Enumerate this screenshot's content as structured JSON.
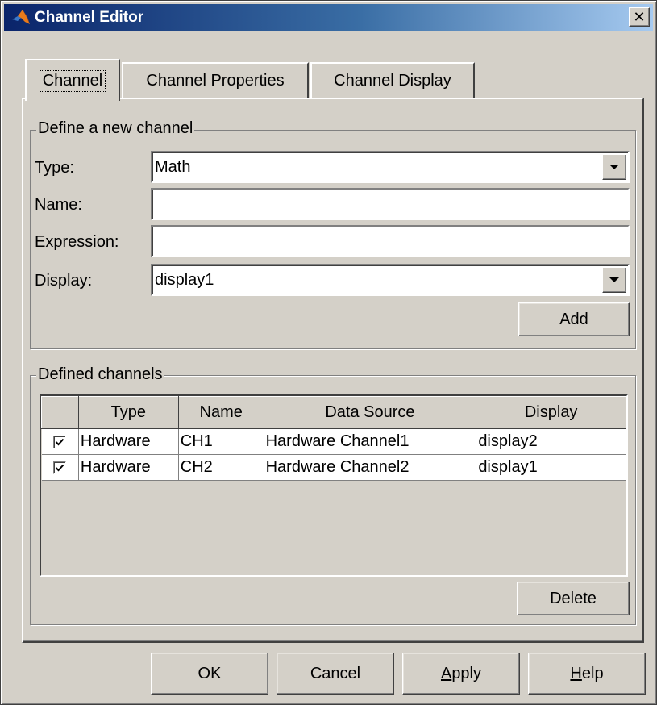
{
  "window": {
    "title": "Channel Editor"
  },
  "tabs": [
    {
      "label": "Channel",
      "active": true
    },
    {
      "label": "Channel Properties",
      "active": false
    },
    {
      "label": "Channel Display",
      "active": false
    }
  ],
  "define": {
    "group_label": "Define a new channel",
    "type_label": "Type:",
    "type_value": "Math",
    "name_label": "Name:",
    "name_value": "",
    "expression_label": "Expression:",
    "expression_value": "",
    "display_label": "Display:",
    "display_value": "display1",
    "add_button": "Add"
  },
  "defined": {
    "group_label": "Defined channels",
    "columns": [
      "",
      "Type",
      "Name",
      "Data Source",
      "Display"
    ],
    "rows": [
      {
        "checked": true,
        "type": "Hardware",
        "name": "CH1",
        "source": "Hardware Channel1",
        "display": "display2"
      },
      {
        "checked": true,
        "type": "Hardware",
        "name": "CH2",
        "source": "Hardware Channel2",
        "display": "display1"
      }
    ],
    "delete_button": "Delete"
  },
  "footer": {
    "ok": "OK",
    "cancel": "Cancel",
    "apply_mnemonic": "A",
    "apply_rest": "pply",
    "help_mnemonic": "H",
    "help_rest": "elp"
  },
  "icons": {
    "app": "matlab-logo-icon",
    "close": "close-icon",
    "dropdown": "chevron-down-icon",
    "check": "check-icon"
  },
  "colors": {
    "face": "#d4d0c8",
    "title_start": "#0a246a",
    "title_end": "#a6caf0"
  }
}
